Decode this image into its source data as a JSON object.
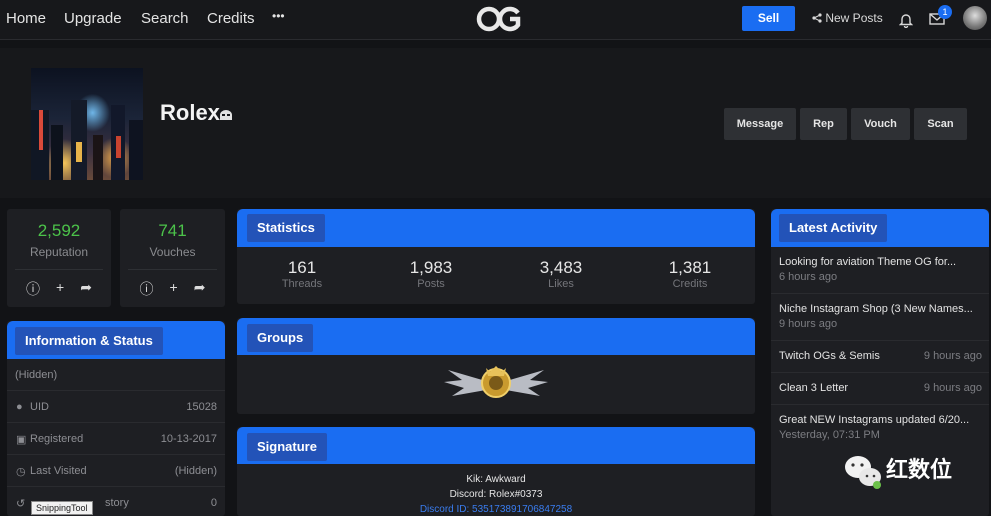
{
  "nav": {
    "links": [
      "Home",
      "Upgrade",
      "Search",
      "Credits"
    ],
    "more": "•••",
    "sell": "Sell",
    "new_posts": "New Posts",
    "notif_badge": "1"
  },
  "profile": {
    "username": "Rolex",
    "buttons": [
      "Message",
      "Rep",
      "Vouch",
      "Scan"
    ]
  },
  "summary": {
    "reputation": {
      "value": "2,592",
      "label": "Reputation"
    },
    "vouches": {
      "value": "741",
      "label": "Vouches"
    }
  },
  "info": {
    "title": "Information & Status",
    "hidden": "(Hidden)",
    "rows": [
      {
        "key": "UID",
        "value": "15028"
      },
      {
        "key": "Registered",
        "value": "10-13-2017"
      },
      {
        "key": "Last Visited",
        "value": "(Hidden)"
      },
      {
        "key": "story",
        "value": "0"
      }
    ]
  },
  "statistics": {
    "title": "Statistics",
    "items": [
      {
        "value": "161",
        "label": "Threads"
      },
      {
        "value": "1,983",
        "label": "Posts"
      },
      {
        "value": "3,483",
        "label": "Likes"
      },
      {
        "value": "1,381",
        "label": "Credits"
      }
    ]
  },
  "groups": {
    "title": "Groups"
  },
  "signature": {
    "title": "Signature",
    "lines": [
      "Kik: Awkward",
      "Discord: Rolex#0373",
      "Discord ID: 535173891706847258"
    ]
  },
  "activity": {
    "title": "Latest Activity",
    "items": [
      {
        "title": "Looking for aviation Theme OG for...",
        "time": "6 hours ago"
      },
      {
        "title": "Niche Instagram Shop (3 New Names...",
        "time": "9 hours ago"
      },
      {
        "title": "Twitch OGs & Semis",
        "time": "9 hours ago"
      },
      {
        "title": "Clean 3 Letter",
        "time": "9 hours ago"
      },
      {
        "title": "Great NEW Instagrams updated 6/20...",
        "time": "Yesterday, 07:31 PM"
      }
    ]
  },
  "overlay": {
    "tooltip": "SnippingTool",
    "watermark": "红数位"
  },
  "colors": {
    "accent": "#1a6df2",
    "positive": "#4cc34a",
    "background": "#121316",
    "card": "#1e1f23"
  }
}
